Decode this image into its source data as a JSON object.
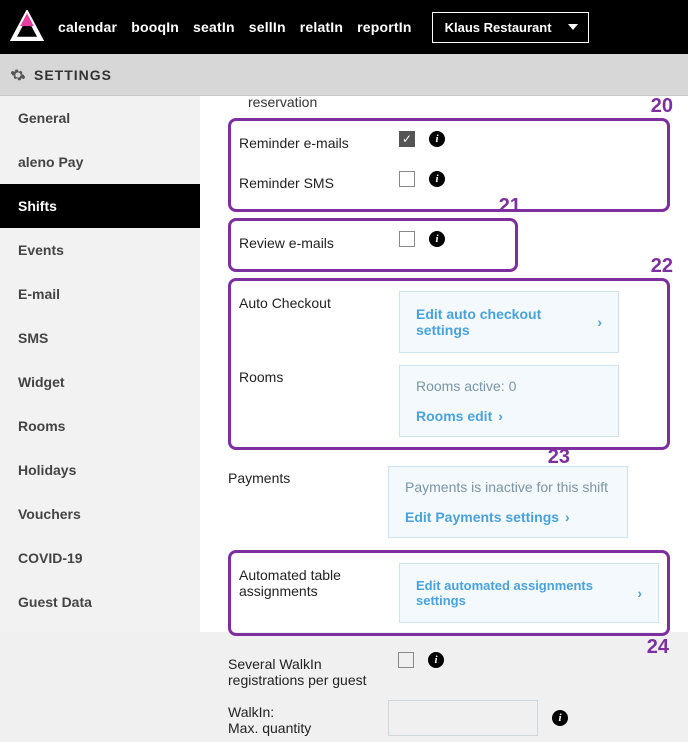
{
  "header": {
    "nav": [
      "calendar",
      "booqIn",
      "seatIn",
      "sellIn",
      "relatIn",
      "reportIn"
    ],
    "restaurant": "Klaus Restaurant"
  },
  "settings_title": "SETTINGS",
  "sidebar": {
    "items": [
      {
        "label": "General"
      },
      {
        "label": "aleno Pay"
      },
      {
        "label": "Shifts",
        "active": true
      },
      {
        "label": "Events"
      },
      {
        "label": "E-mail"
      },
      {
        "label": "SMS"
      },
      {
        "label": "Widget"
      },
      {
        "label": "Rooms"
      },
      {
        "label": "Holidays"
      },
      {
        "label": "Vouchers"
      },
      {
        "label": "COVID-19"
      },
      {
        "label": "Guest Data"
      }
    ]
  },
  "content": {
    "truncated_row": "reservation",
    "groups": {
      "g20": {
        "num": "20",
        "rows": [
          {
            "label": "Reminder e-mails",
            "checked": true
          },
          {
            "label": "Reminder SMS",
            "checked": false
          }
        ]
      },
      "g21": {
        "num": "21",
        "label": "Review e-mails",
        "checked": false
      },
      "g22": {
        "num": "22",
        "auto_label": "Auto Checkout",
        "auto_btn": "Edit auto checkout settings",
        "rooms_label": "Rooms",
        "rooms_status": "Rooms active: 0",
        "rooms_link": "Rooms edit"
      },
      "g23": {
        "num": "23",
        "payments_label": "Payments",
        "payments_status": "Payments is inactive for this shift",
        "payments_link": "Edit Payments settings"
      },
      "g24": {
        "num": "24",
        "auto_assign_label": "Automated table assignments",
        "auto_assign_btn": "Edit automated assignments settings"
      },
      "walkin_multi": {
        "label": "Several WalkIn registrations per guest",
        "checked": false
      },
      "walkin_max": {
        "label": "WalkIn:\nMax. quantity"
      }
    }
  }
}
